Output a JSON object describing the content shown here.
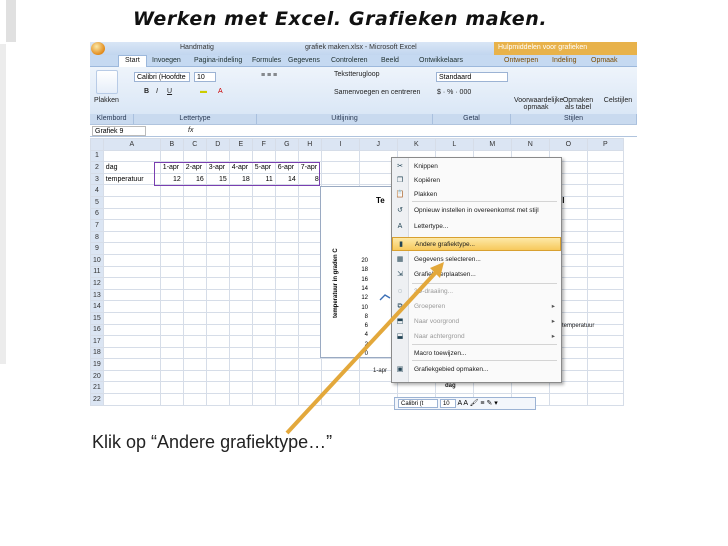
{
  "slide": {
    "title": "Werken met Excel. Grafieken maken.",
    "caption": "Klik op “Andere grafiektype…”"
  },
  "excel": {
    "quick_access_label": "Handmatig",
    "window_title": "grafiek maken.xlsx - Microsoft Excel",
    "contextual_title": "Hulpmiddelen voor grafieken",
    "tabs": [
      "Start",
      "Invoegen",
      "Pagina-indeling",
      "Formules",
      "Gegevens",
      "Controleren",
      "Beeld",
      "Ontwikkelaars",
      "Ontwerpen",
      "Indeling",
      "Opmaak"
    ],
    "ribbon": {
      "paste_label": "Plakken",
      "font_name": "Calibri (Hoofdte",
      "font_size": "10",
      "wrap_text": "Tekstterugloop",
      "merge_center": "Samenvoegen en centreren",
      "number_format": "Standaard",
      "cond_format": "Voorwaardelijke opmaak",
      "format_table": "Opmaken als tabel",
      "cell_styles": "Celstijlen",
      "groups": [
        "Klembord",
        "Lettertype",
        "Uitlijning",
        "Getal",
        "Stijlen"
      ]
    },
    "name_box": "Grafiek 9",
    "fx_label": "fx",
    "columns": [
      "A",
      "B",
      "C",
      "D",
      "E",
      "F",
      "G",
      "H",
      "I",
      "J",
      "K",
      "L",
      "M",
      "N",
      "O",
      "P"
    ],
    "rows": [
      [
        "dag",
        "1-apr",
        "2-apr",
        "3-apr",
        "4-apr",
        "5-apr",
        "6-apr",
        "7-apr"
      ],
      [
        "temperatuur",
        "12",
        "16",
        "15",
        "18",
        "11",
        "14",
        "8"
      ]
    ],
    "row_count": 22
  },
  "chart": {
    "title_left": "Te",
    "title_right": "il",
    "ylabel": "temperatuur in graden C",
    "yticks": [
      "20",
      "18",
      "16",
      "14",
      "12",
      "10",
      "8",
      "6",
      "4",
      "2",
      "0"
    ],
    "xtick_first": "1-apr",
    "legend": "temperatuur",
    "xlabel": "dag"
  },
  "context_menu": {
    "items": [
      {
        "icon": "scissors-icon",
        "glyph": "✂",
        "label": "Knippen",
        "disabled": false
      },
      {
        "icon": "copy-icon",
        "glyph": "❐",
        "label": "Kopiëren",
        "disabled": false
      },
      {
        "icon": "paste-icon",
        "glyph": "📋",
        "label": "Plakken",
        "disabled": false
      },
      {
        "icon": "reset-style-icon",
        "glyph": "↺",
        "label": "Opnieuw instellen in overeenkomst met stijl",
        "disabled": false
      },
      {
        "icon": "font-icon",
        "glyph": "A",
        "label": "Lettertype...",
        "disabled": false
      },
      {
        "icon": "chart-type-icon",
        "glyph": "▮",
        "label": "Andere grafiektype...",
        "disabled": false,
        "highlighted": true
      },
      {
        "icon": "select-data-icon",
        "glyph": "▦",
        "label": "Gegevens selecteren...",
        "disabled": false
      },
      {
        "icon": "move-chart-icon",
        "glyph": "⇲",
        "label": "Grafiek verplaatsen...",
        "disabled": false
      },
      {
        "icon": "3d-rotation-icon",
        "glyph": "◌",
        "label": "3D-draaiing...",
        "disabled": true
      },
      {
        "icon": "group-icon",
        "glyph": "⧉",
        "label": "Groeperen",
        "disabled": true,
        "submenu": true
      },
      {
        "icon": "bring-forward-icon",
        "glyph": "⬒",
        "label": "Naar voorgrond",
        "disabled": true,
        "submenu": true
      },
      {
        "icon": "send-backward-icon",
        "glyph": "⬓",
        "label": "Naar achtergrond",
        "disabled": true,
        "submenu": true
      },
      {
        "icon": "macro-icon",
        "glyph": "",
        "label": "Macro toewijzen...",
        "disabled": false
      },
      {
        "icon": "format-chart-area-icon",
        "glyph": "▣",
        "label": "Grafiekgebied opmaken...",
        "disabled": false
      }
    ]
  },
  "mini_toolbar": {
    "font": "Calibri (t",
    "size": "10"
  }
}
